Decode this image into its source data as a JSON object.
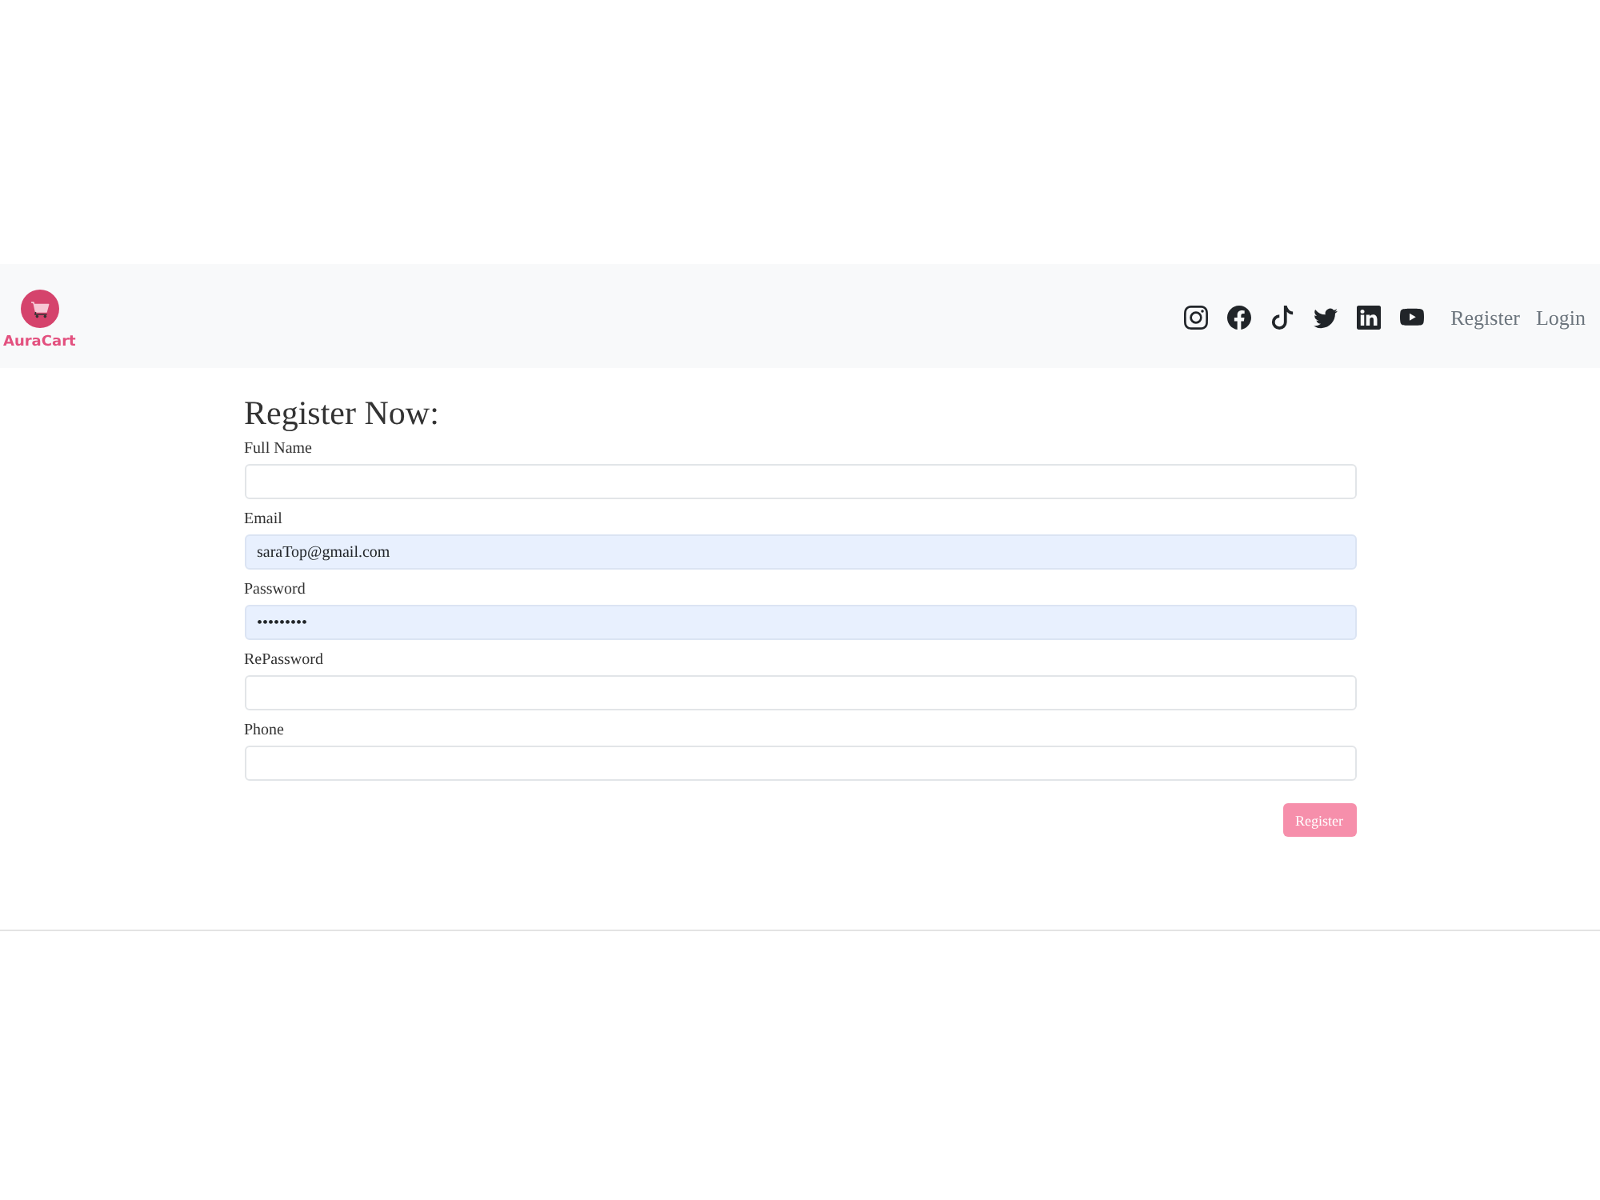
{
  "navbar": {
    "brand": "AuraCart",
    "links": [
      {
        "label": "Register",
        "selected": false
      },
      {
        "label": "Login",
        "selected": false
      }
    ]
  },
  "form": {
    "title": "Register Now:",
    "fields": [
      {
        "label": "Full Name",
        "autofilled": false
      },
      {
        "label": "Email",
        "value": "saraTop@gmail.com",
        "autofilled": true
      },
      {
        "label": "Password",
        "value": "•••••••••",
        "autofilled": true
      },
      {
        "label": "RePassword",
        "autofilled": false
      },
      {
        "label": "Phone",
        "autofilled": false
      }
    ],
    "submit": {
      "label": "Register"
    }
  }
}
